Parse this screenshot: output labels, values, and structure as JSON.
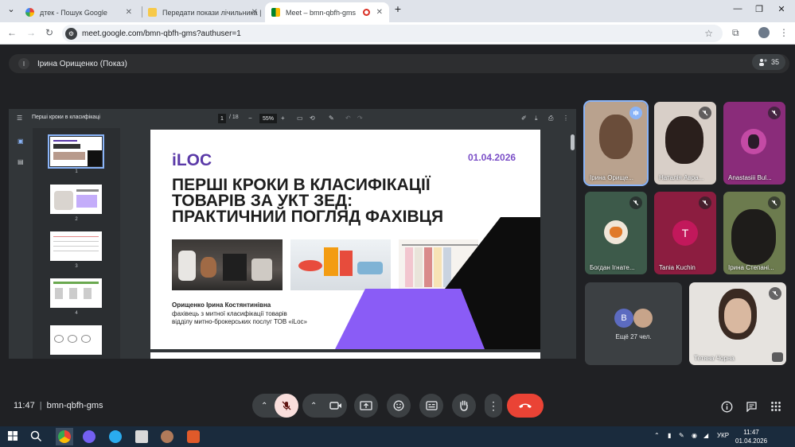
{
  "browser": {
    "tabs": [
      {
        "label": "дтек - Пошук Google",
        "favicon": "google-icon"
      },
      {
        "label": "Передати покази лічильника |",
        "favicon": "dtek-icon"
      },
      {
        "label": "Meet – bmn-qbfh-gms",
        "favicon": "meet-icon"
      }
    ],
    "new_tab": "+",
    "url": "meet.google.com/bmn-qbfh-gms?authuser=1"
  },
  "meet": {
    "presenter_initial": "І",
    "presenter_label": "Ірина Орищенко (Показ)",
    "participants_count": "35",
    "meeting_time": "11:47",
    "meeting_sep": "|",
    "meeting_code": "bmn-qbfh-gms"
  },
  "viewer": {
    "doc_title": "Перші кроки в класифікаці",
    "page_current": "1",
    "page_total": "/ 18",
    "zoom": "55%",
    "thumb_numbers": [
      "1",
      "2",
      "3",
      "4"
    ]
  },
  "slide": {
    "logo": "iLOC",
    "date": "01.04.2026",
    "title_lines": [
      "ПЕРШІ КРОКИ В КЛАСИФІКАЦІЇ",
      "ТОВАРІВ ЗА УКТ ЗЕД:",
      "ПРАКТИЧНИЙ ПОГЛЯД ФАХІВЦЯ"
    ],
    "author": "Орищенко Ірина Костянтинівна",
    "role_line1": "фахівець з митної класифікації товарів",
    "role_line2": "відділу митно-брокерських послуг ТОВ «iLoc»",
    "accent_purple": "#8a5cf6",
    "logo_color": "#5b3aa8"
  },
  "participants": [
    {
      "name": "Ірина Орище...",
      "state": "speaking"
    },
    {
      "name": "Наталія Авра...",
      "state": "muted"
    },
    {
      "name": "Anastasiii Bul...",
      "state": "muted"
    },
    {
      "name": "Богдан Ігнате...",
      "state": "muted"
    },
    {
      "name": "Tania Kuchin",
      "state": "muted",
      "initial": "T"
    },
    {
      "name": "Ірина Степані...",
      "state": "muted"
    },
    {
      "name": "Тетяна Чорна",
      "state": "muted"
    }
  ],
  "others": {
    "initial": "B",
    "label": "Ещё 27 чел."
  },
  "colors": {
    "meet_bg": "#202124",
    "end_call_red": "#ea4335",
    "muted_mic_bg": "#f9dedc",
    "speaking_outline": "#8ab4f8"
  },
  "taskbar": {
    "lang": "УКР",
    "time": "11:47",
    "date": "01.04.2026"
  }
}
